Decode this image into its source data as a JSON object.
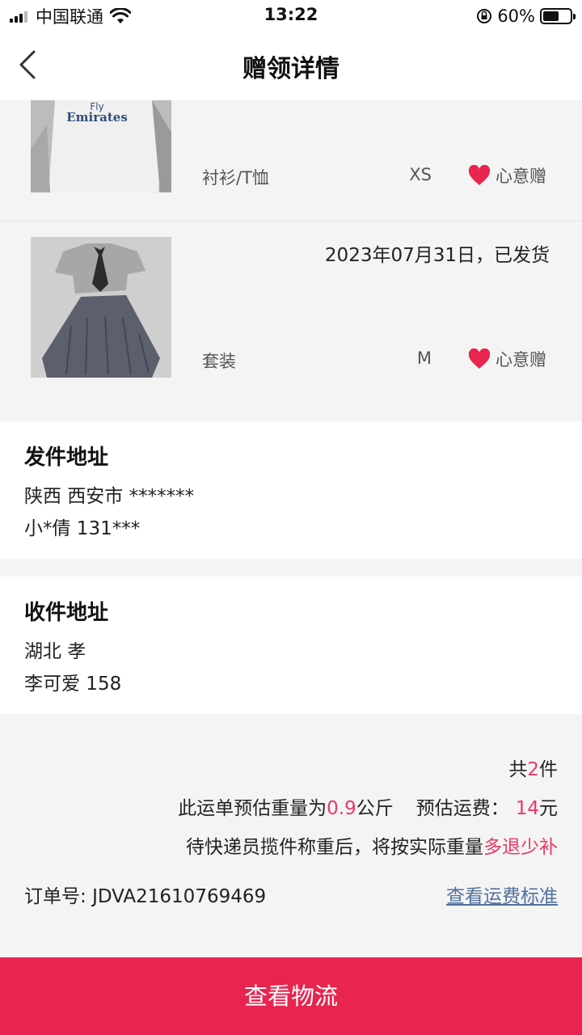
{
  "status_bar": {
    "carrier": "中国联通",
    "time": "13:22",
    "battery": "60%",
    "battery_level": 0.6
  },
  "nav": {
    "title": "赠领详情"
  },
  "items": [
    {
      "category": "衬衫/T恤",
      "size": "XS",
      "gift_label": "心意赠",
      "print_text_1": "Fly",
      "print_text_2": "Emirates"
    },
    {
      "status": "2023年07月31日，已发货",
      "category": "套装",
      "size": "M",
      "gift_label": "心意赠"
    }
  ],
  "sender": {
    "title": "发件地址",
    "region": "陕西 西安市 *******",
    "contact": "小*倩 131***"
  },
  "receiver": {
    "title": "收件地址",
    "region": "湖北 孝",
    "contact": "李可爱 158"
  },
  "summary": {
    "count_prefix": "共",
    "count": "2",
    "count_suffix": "件",
    "weight_prefix": "此运单预估重量为",
    "weight": "0.9",
    "weight_unit": "公斤",
    "fee_prefix": "预估运费：",
    "fee": "14",
    "fee_unit": "元",
    "note_prefix": "待快递员揽件称重后，将按实际重量",
    "note_highlight": "多退少补",
    "order_label": "订单号:",
    "order_no": "JDVA21610769469",
    "fee_link": "查看运费标准"
  },
  "button": {
    "label": "查看物流"
  },
  "colors": {
    "accent": "#e8254f",
    "highlight": "#e83a62",
    "link": "#52709e"
  }
}
